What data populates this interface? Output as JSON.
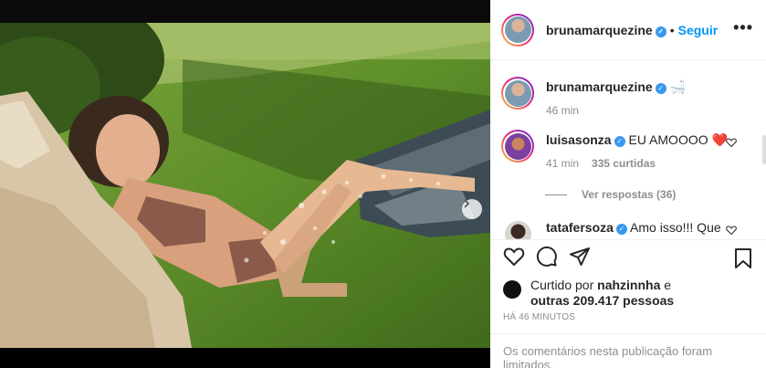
{
  "post": {
    "slide_count": 3,
    "active_slide": 1
  },
  "header": {
    "username": "bruna​marquezine",
    "verified": true,
    "separator": "•",
    "follow_label": "Seguir",
    "more_label": "•••"
  },
  "caption": {
    "username": "brunamarquezine",
    "emoji": "🛁",
    "time": "46 min"
  },
  "comments": [
    {
      "username": "luisasonza",
      "text": "EU AMOOOO",
      "emoji": "❤️",
      "time": "41 min",
      "likes": "335 curtidas",
      "replies_label": "Ver respostas (36)"
    },
    {
      "username": "tatafersoza",
      "text": "Amo isso!!! Que"
    }
  ],
  "likes": {
    "prefix": "Curtido por",
    "user": "nahzinnha",
    "connector": "e",
    "others": "outras 209.417 pessoas"
  },
  "timestamp": "HÁ 46 MINUTOS",
  "limited_notice": "Os comentários nesta publicação foram limitados.",
  "colors": {
    "link": "#0095f6",
    "verified": "#3897f0",
    "text": "#262626",
    "muted": "#8e8e8e",
    "heart": "#ed4956"
  }
}
